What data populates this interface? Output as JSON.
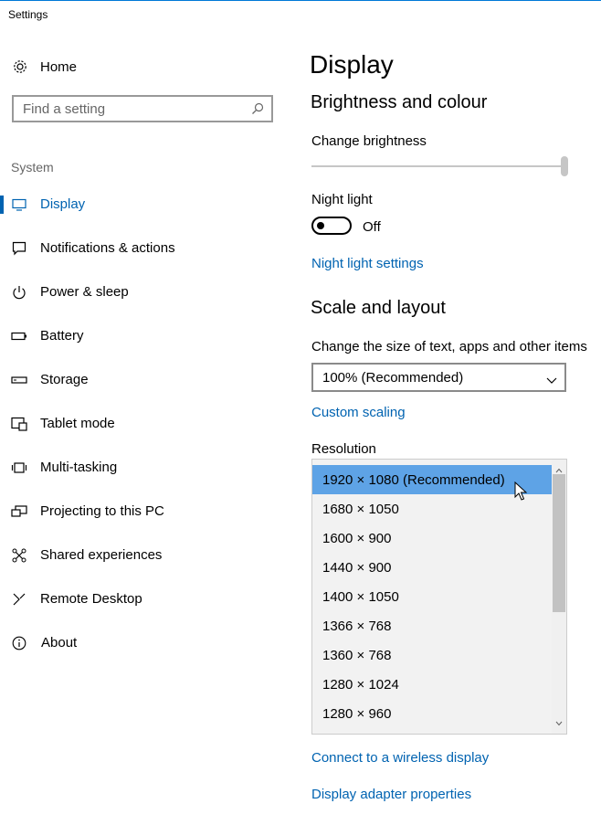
{
  "window": {
    "title": "Settings"
  },
  "sidebar": {
    "home_label": "Home",
    "search_placeholder": "Find a setting",
    "section_label": "System",
    "items": [
      {
        "label": "Display",
        "icon": "monitor-icon",
        "active": true
      },
      {
        "label": "Notifications & actions",
        "icon": "chat-bubble-icon"
      },
      {
        "label": "Power & sleep",
        "icon": "power-icon"
      },
      {
        "label": "Battery",
        "icon": "battery-icon"
      },
      {
        "label": "Storage",
        "icon": "storage-drive-icon"
      },
      {
        "label": "Tablet mode",
        "icon": "tablet-mode-icon"
      },
      {
        "label": "Multi-tasking",
        "icon": "multitasking-icon"
      },
      {
        "label": "Projecting to this PC",
        "icon": "projecting-icon"
      },
      {
        "label": "Shared experiences",
        "icon": "shared-experiences-icon"
      },
      {
        "label": "Remote Desktop",
        "icon": "remote-desktop-icon"
      },
      {
        "label": "About",
        "icon": "info-icon"
      }
    ]
  },
  "main": {
    "page_title": "Display",
    "brightness_heading": "Brightness and colour",
    "change_brightness_label": "Change brightness",
    "brightness_level": 1.0,
    "night_light_label": "Night light",
    "night_light_state": "Off",
    "night_light_settings_link": "Night light settings",
    "scale_heading": "Scale and layout",
    "scale_label": "Change the size of text, apps and other items",
    "scale_value": "100% (Recommended)",
    "custom_scaling_link": "Custom scaling",
    "resolution_label": "Resolution",
    "resolution_options": [
      "1920 × 1080 (Recommended)",
      "1680 × 1050",
      "1600 × 900",
      "1440 × 900",
      "1400 × 1050",
      "1366 × 768",
      "1360 × 768",
      "1280 × 1024",
      "1280 × 960"
    ],
    "resolution_selected": "1920 × 1080 (Recommended)",
    "wireless_display_link": "Connect to a wireless display",
    "adapter_properties_link": "Display adapter properties"
  },
  "colors": {
    "accent": "#0063b1",
    "selection": "#5ea3e6",
    "list_background": "#f2f2f2"
  }
}
